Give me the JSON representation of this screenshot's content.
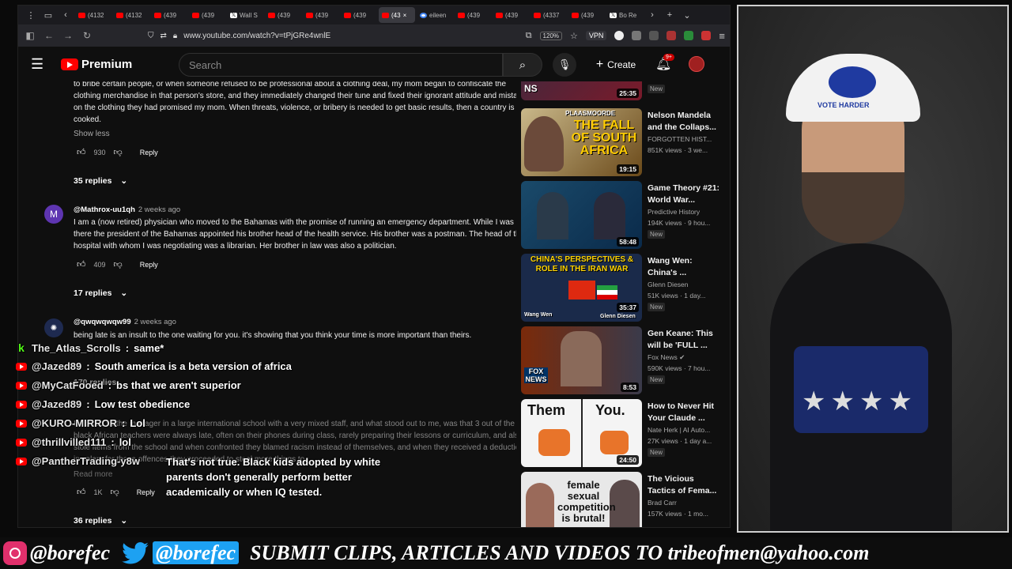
{
  "browser": {
    "tabs": [
      {
        "label": "(4132",
        "icon": "youtube"
      },
      {
        "label": "(4132",
        "icon": "youtube"
      },
      {
        "label": "(439",
        "icon": "youtube"
      },
      {
        "label": "(439",
        "icon": "youtube"
      },
      {
        "label": "Wall S",
        "icon": "x"
      },
      {
        "label": "(439",
        "icon": "youtube"
      },
      {
        "label": "(439",
        "icon": "youtube"
      },
      {
        "label": "(439",
        "icon": "youtube"
      },
      {
        "label": "(43",
        "icon": "youtube",
        "active": true
      },
      {
        "label": "eileen",
        "icon": "google"
      },
      {
        "label": "(439",
        "icon": "youtube"
      },
      {
        "label": "(439",
        "icon": "youtube"
      },
      {
        "label": "(4337",
        "icon": "youtube"
      },
      {
        "label": "(439",
        "icon": "youtube"
      },
      {
        "label": "Bo Re",
        "icon": "x"
      }
    ],
    "url": "www.youtube.com/watch?v=tPjGRe4wnlE",
    "zoom": "120%",
    "vpn": "VPN"
  },
  "youtube": {
    "logo": "Premium",
    "search_placeholder": "Search",
    "create_label": "Create",
    "notification_count": "9+"
  },
  "comments": {
    "first": {
      "text": "to bribe certain people, or when someone refused to be professional about a clothing deal, my mom began to confiscate the clothing merchandise in that person's store, and they immediately changed their tune and fixed their ignorant attitude and mistake on the clothing they had promised my mom. When threats, violence, or bribery is needed to get basic results, then a country is cooked.",
      "show_less": "Show less",
      "likes": "930",
      "reply": "Reply",
      "replies": "35 replies"
    },
    "second": {
      "avatar": "M",
      "author": "@Mathrox-uu1qh",
      "time": "2 weeks ago",
      "text": "I am a (now retired) physician who moved to the Bahamas with the promise of running an emergency department. While I was there the president of the Bahamas appointed his brother head of the health service. His brother was a postman. The head of the hospital with whom I was negotiating was a librarian. Her brother in law was also a politician.",
      "likes": "409",
      "reply": "Reply",
      "replies": "17 replies"
    },
    "third": {
      "author": "@qwqwqwqw99",
      "time": "2 weeks ago",
      "text": "being late is an insult to the one waiting for you. it's showing that you think your time is more important than theirs.",
      "replies": "170 replies"
    },
    "fourth": {
      "text": "I worked as the manager in a large international school with a very mixed staff, and what stood out to me, was that 3 out of the 4 black African teachers were always late, often on their phones during class, rarely preparing their lessons or curriculum, and also stole items from the school and when confronted they blamed racism instead of themselves, and when they received a deduction in salary for those offences they proceeded to steal more things to ...",
      "read_more": "Read more",
      "likes": "1K",
      "reply": "Reply",
      "replies": "36 replies"
    }
  },
  "sidebar": [
    {
      "title": "",
      "channel": "",
      "meta": "",
      "duration": "25:35",
      "badge": "New"
    },
    {
      "title": "Nelson Mandela and the Collaps...",
      "channel": "FORGOTTEN HIST...",
      "meta": "851K views · 3 we...",
      "duration": "19:15",
      "badge": "",
      "thumb_text": "THE FALL OF SOUTH AFRICA",
      "thumb_header": "PLAASMOORDE"
    },
    {
      "title": "Game Theory #21: World War...",
      "channel": "Predictive History",
      "meta": "194K views · 9 hou...",
      "duration": "58:48",
      "badge": "New"
    },
    {
      "title": "Wang Wen: China's ...",
      "channel": "Glenn Diesen",
      "meta": "51K views · 1 day...",
      "duration": "35:37",
      "badge": "New",
      "thumb_text": "CHINA'S PERSPECTIVES & ROLE IN THE IRAN WAR",
      "thumb_left": "Wang Wen",
      "thumb_right": "Glenn Diesen"
    },
    {
      "title": "Gen Keane: This will be 'FULL ...",
      "channel": "Fox News",
      "meta": "590K views · 7 hou...",
      "duration": "8:53",
      "badge": "New",
      "thumb_text": "FOX NEWS"
    },
    {
      "title": "How to Never Hit Your Claude ...",
      "channel": "Nate Herk | AI Auto...",
      "meta": "27K views · 1 day a...",
      "duration": "24:50",
      "badge": "New",
      "thumb_left": "Them",
      "thumb_right": "You."
    },
    {
      "title": "The Vicious Tactics of Fema...",
      "channel": "Brad Carr",
      "meta": "157K views · 1 mo...",
      "duration": "",
      "badge": "",
      "thumb_text": "female sexual competition is brutal!"
    }
  ],
  "chat": [
    {
      "platform": "kick",
      "user": "The_Atlas_Scrolls",
      "message": "same*"
    },
    {
      "platform": "youtube",
      "user": "@Jazed89",
      "message": "South america is a beta version of africa"
    },
    {
      "platform": "youtube",
      "user": "@MyCatFooed",
      "message": "bs that we aren't superior"
    },
    {
      "platform": "youtube",
      "user": "@Jazed89",
      "message": "Low test obedience"
    },
    {
      "platform": "youtube",
      "user": "@KURO-MIRROR",
      "message": "Lol"
    },
    {
      "platform": "youtube",
      "user": "@thrillvilled111",
      "message": "lol"
    },
    {
      "platform": "youtube",
      "user": "@PantherTrading-y8w",
      "message": "That's not true. Black kids adopted by white parents don't generally perform better academically or when IQ tested."
    }
  ],
  "webcam": {
    "cap_text": "VOTE HARDER"
  },
  "banner": {
    "instagram": "@borefec",
    "twitter": "@borefec",
    "message": "SUBMIT CLIPS, ARTICLES AND VIDEOS TO tribeofmen@yahoo.com"
  }
}
